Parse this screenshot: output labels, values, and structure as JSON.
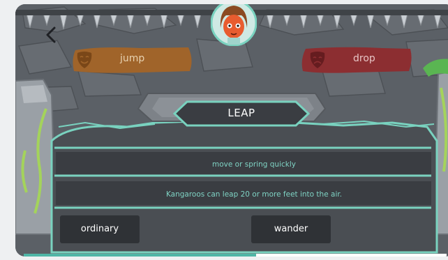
{
  "game": {
    "word": "LEAP",
    "choices_top": [
      {
        "label": "jump",
        "color": "#a0642a"
      },
      {
        "label": "drop",
        "color": "#8c2e31"
      }
    ],
    "definition": "move or spring quickly",
    "example": "Kangaroos can leap 20 or more feet into the air.",
    "options": [
      "ordinary",
      "wander"
    ],
    "progress": 0.55
  },
  "icons": {
    "back": "chevron-left-icon",
    "avatar": "character-avatar",
    "happy_mask": "happy-mask-icon",
    "sad_mask": "sad-mask-icon"
  },
  "colors": {
    "accent": "#79d2bf",
    "plaque": "#3a3d42",
    "wall": "#5b6066"
  }
}
